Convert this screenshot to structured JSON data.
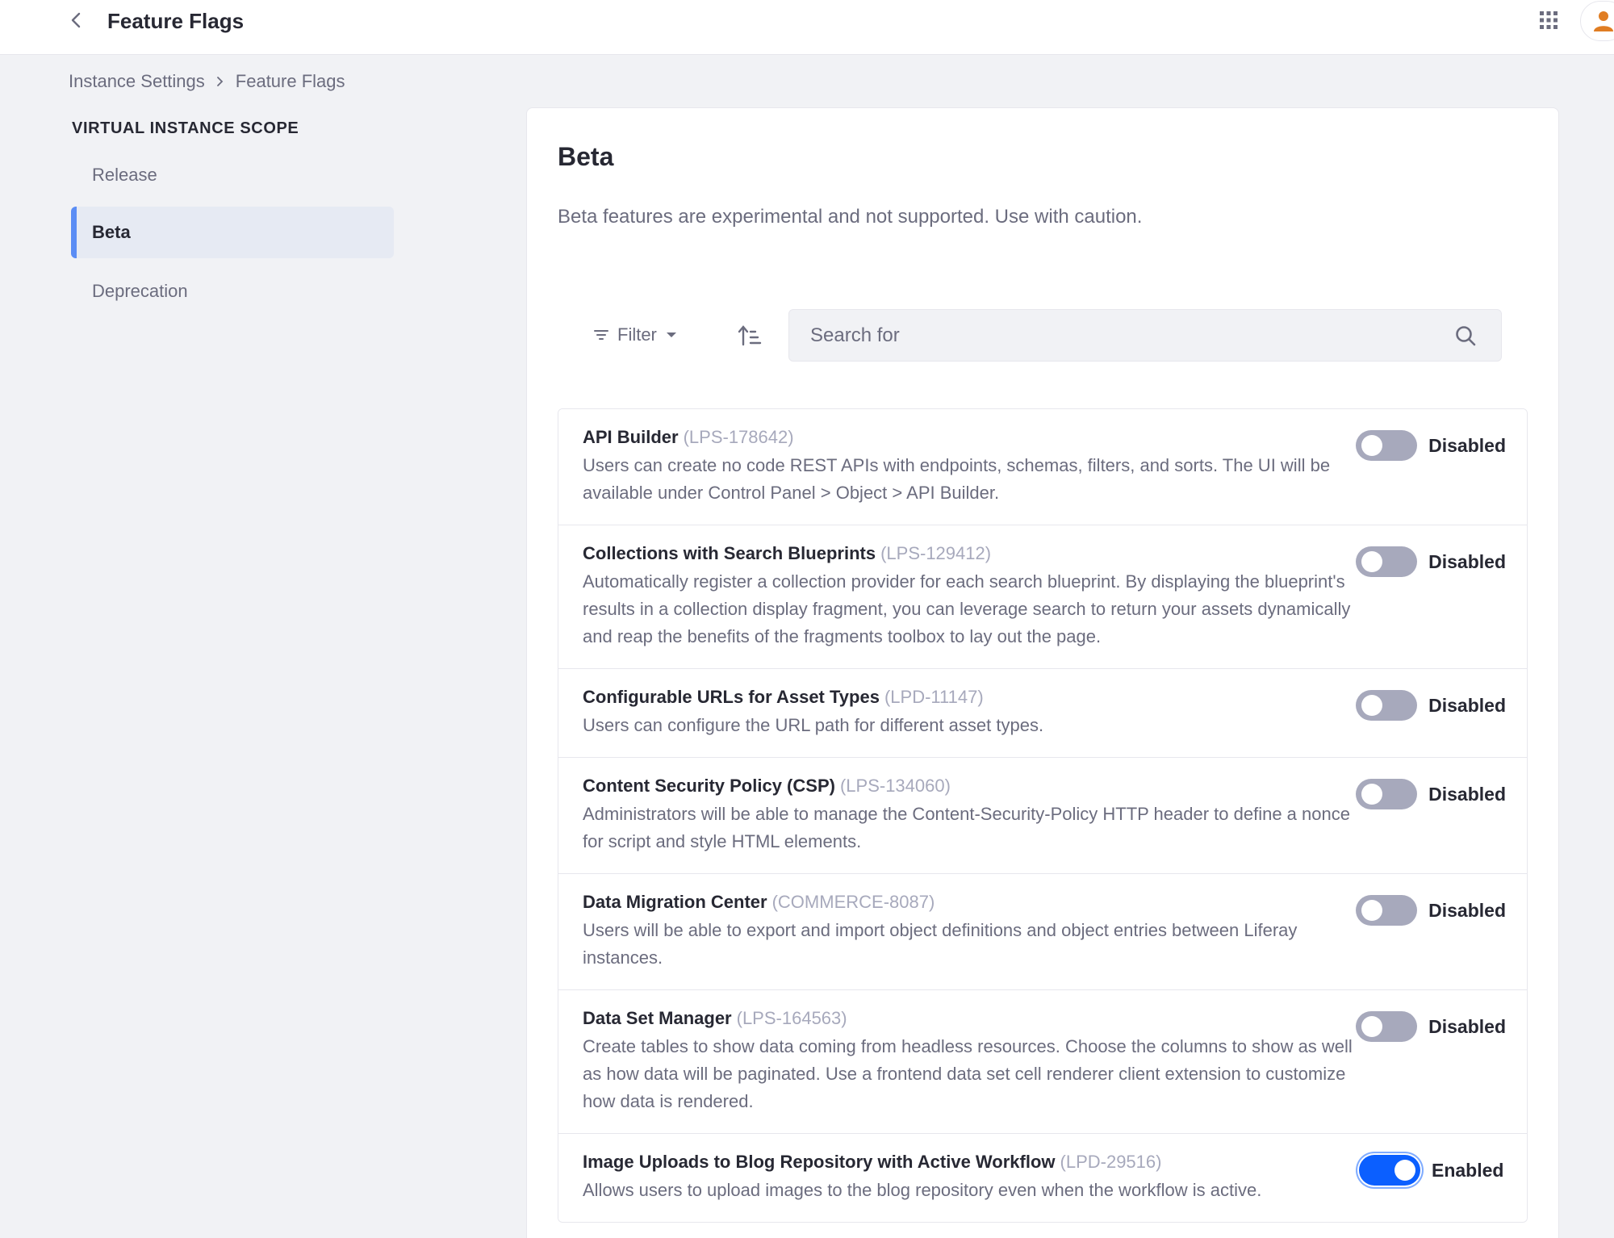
{
  "header": {
    "title": "Feature Flags",
    "icons": {
      "back": "chevron-left-icon",
      "apps": "grid-icon",
      "user": "user-icon"
    }
  },
  "breadcrumb": {
    "items": [
      "Instance Settings",
      "Feature Flags"
    ]
  },
  "sidebar": {
    "scope_title": "VIRTUAL INSTANCE SCOPE",
    "items": [
      {
        "label": "Release",
        "active": false
      },
      {
        "label": "Beta",
        "active": true
      },
      {
        "label": "Deprecation",
        "active": false
      }
    ]
  },
  "main": {
    "title": "Beta",
    "description": "Beta features are experimental and not supported. Use with caution.",
    "toolbar": {
      "filter_label": "Filter",
      "search_placeholder": "Search for",
      "search_value": ""
    },
    "flags": [
      {
        "name": "API Builder",
        "id": "(LPS-178642)",
        "description": "Users can create no code REST APIs with endpoints, schemas, filters, and sorts. The UI will be available under Control Panel > Object > API Builder.",
        "status": "Disabled",
        "enabled": false
      },
      {
        "name": "Collections with Search Blueprints",
        "id": "(LPS-129412)",
        "description": "Automatically register a collection provider for each search blueprint. By displaying the blueprint's results in a collection display fragment, you can leverage search to return your assets dynamically and reap the benefits of the fragments toolbox to lay out the page.",
        "status": "Disabled",
        "enabled": false
      },
      {
        "name": "Configurable URLs for Asset Types",
        "id": "(LPD-11147)",
        "description": "Users can configure the URL path for different asset types.",
        "status": "Disabled",
        "enabled": false
      },
      {
        "name": "Content Security Policy (CSP)",
        "id": "(LPS-134060)",
        "description": "Administrators will be able to manage the Content-Security-Policy HTTP header to define a nonce for script and style HTML elements.",
        "status": "Disabled",
        "enabled": false
      },
      {
        "name": "Data Migration Center",
        "id": "(COMMERCE-8087)",
        "description": "Users will be able to export and import object definitions and object entries between Liferay instances.",
        "status": "Disabled",
        "enabled": false
      },
      {
        "name": "Data Set Manager",
        "id": "(LPS-164563)",
        "description": "Create tables to show data coming from headless resources. Choose the columns to show as well as how data will be paginated. Use a frontend data set cell renderer client extension to customize how data is rendered.",
        "status": "Disabled",
        "enabled": false
      },
      {
        "name": "Image Uploads to Blog Repository with Active Workflow",
        "id": "(LPD-29516)",
        "description": "Allows users to upload images to the blog repository even when the workflow is active.",
        "status": "Enabled",
        "enabled": true
      }
    ]
  },
  "colors": {
    "accent": "#0b5fff",
    "nav_indicator": "#5b8df5",
    "toggle_off": "#a7a9bc",
    "user_icon": "#e07d23"
  }
}
